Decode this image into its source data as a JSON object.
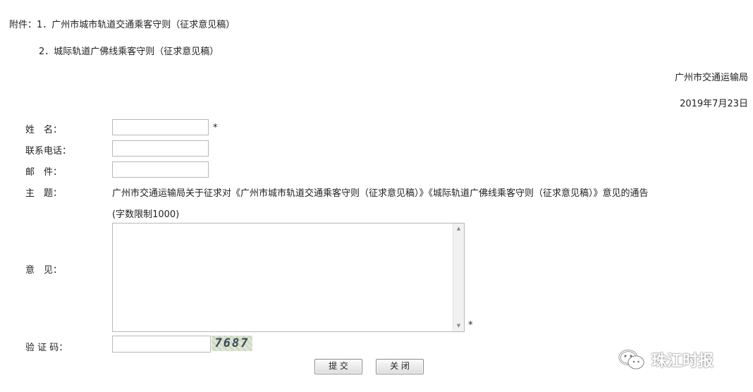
{
  "attachments": {
    "line1": "附件：1．广州市城市轨道交通乘客守则（征求意见稿）",
    "line2": "2．城际轨道广佛线乘客守则（征求意见稿）"
  },
  "issuer": "广州市交通运输局",
  "date": "2019年7月23日",
  "form": {
    "name_label": "姓　名：",
    "phone_label": "联系电话：",
    "email_label": "邮　件：",
    "subject_label": "主　题：",
    "subject_value": "广州市交通运输局关于征求对《广州市城市轨道交通乘客守则（征求意见稿）》《城际轨道广佛线乘客守则（征求意见稿）》意见的通告",
    "limit_note": "(字数限制1000)",
    "opinion_label": "意　见：",
    "captcha_label": "验 证 码：",
    "captcha_code": "7687",
    "required_mark": "*",
    "name_value": "",
    "phone_value": "",
    "email_value": "",
    "opinion_value": "",
    "captcha_value": ""
  },
  "buttons": {
    "submit": "提 交",
    "close": "关 闭"
  },
  "watermark": {
    "text": "珠江时报",
    "icon": "wechat-icon"
  }
}
